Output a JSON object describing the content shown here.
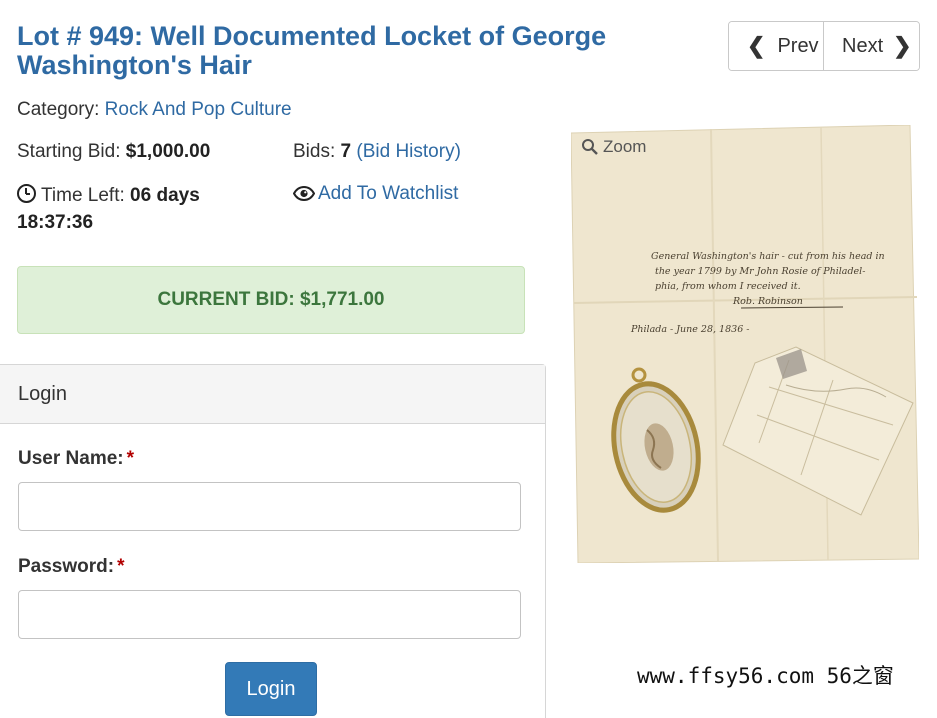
{
  "lot": {
    "title": "Lot # 949: Well Documented Locket of George Washington's Hair"
  },
  "nav": {
    "prev_label": "Prev",
    "next_label": "Next"
  },
  "category": {
    "label": "Category:",
    "value": "Rock And Pop Culture"
  },
  "starting_bid": {
    "label": "Starting Bid:",
    "value": "$1,000.00"
  },
  "bids": {
    "label": "Bids:",
    "count": "7",
    "history_link": "(Bid History)"
  },
  "time_left": {
    "label": "Time Left:",
    "value": "06 days 18:37:36"
  },
  "watchlist": {
    "label": "Add To Watchlist"
  },
  "current_bid": {
    "text": "CURRENT BID: $1,771.00"
  },
  "login": {
    "header": "Login",
    "username_label": "User Name:",
    "password_label": "Password:",
    "required_mark": "*",
    "username_value": "",
    "password_value": "",
    "button_label": "Login"
  },
  "image": {
    "zoom_label": "Zoom",
    "handwriting_lines": [
      "General Washington's hair - cut from his head in",
      "the year 1799 by Mr John Rosie of Philadel-",
      "phia, from whom I received it.",
      "Rob. Robinson",
      "Philada - June 28, 1836 -"
    ]
  },
  "watermark": {
    "text": "www.ffsy56.com 56之窗"
  },
  "colors": {
    "link": "#2f6aa3",
    "current_bid_bg": "#dff0d8",
    "current_bid_text": "#3c763d",
    "login_button": "#337ab7",
    "required": "#b20000"
  }
}
